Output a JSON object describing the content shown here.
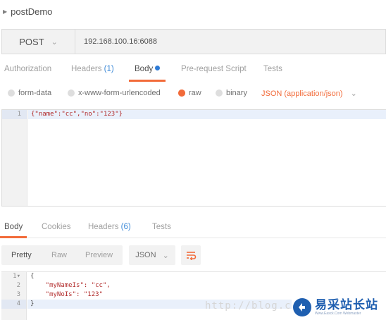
{
  "request": {
    "name": "postDemo",
    "method": "POST",
    "url": "192.168.100.16:6088"
  },
  "request_tabs": [
    {
      "label": "Authorization"
    },
    {
      "label": "Headers",
      "count": "(1)"
    },
    {
      "label": "Body"
    },
    {
      "label": "Pre-request Script"
    },
    {
      "label": "Tests"
    }
  ],
  "body_options": {
    "form_data": "form-data",
    "urlencoded": "x-www-form-urlencoded",
    "raw": "raw",
    "binary": "binary",
    "selected": "raw",
    "content_type": "JSON (application/json)"
  },
  "request_body": {
    "line_numbers": [
      "1"
    ],
    "lines": [
      "{\"name\":\"cc\",\"no\":\"123\"}"
    ]
  },
  "response_tabs": [
    {
      "label": "Body"
    },
    {
      "label": "Cookies"
    },
    {
      "label": "Headers",
      "count": "(6)"
    },
    {
      "label": "Tests"
    }
  ],
  "response_toolbar": {
    "pretty": "Pretty",
    "raw": "Raw",
    "preview": "Preview",
    "format": "JSON"
  },
  "response_body": {
    "line_numbers": [
      "1",
      "2",
      "3",
      "4"
    ],
    "lines": [
      "{",
      "    \"myNameIs\": \"cc\",",
      "    \"myNoIs\": \"123\"",
      "}"
    ]
  },
  "watermark": {
    "url_text": "http://blog.c",
    "logo_text": "易采站长站",
    "logo_sub": "Www.Easck.Com Webmaster"
  },
  "colors": {
    "accent": "#f26b3a",
    "link_blue": "#3f8bd8",
    "logo_blue": "#1f5fb0"
  }
}
